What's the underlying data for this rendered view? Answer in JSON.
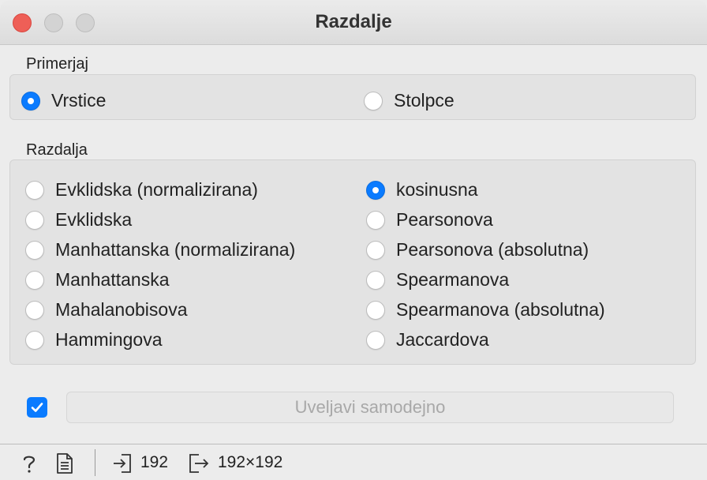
{
  "window": {
    "title": "Razdalje"
  },
  "examples": {
    "label": "Primerjaj",
    "options": [
      {
        "label": "Vrstice",
        "selected": true
      },
      {
        "label": "Stolpce",
        "selected": false
      }
    ]
  },
  "distance": {
    "label": "Razdalja",
    "left": [
      {
        "label": "Evklidska (normalizirana)",
        "selected": false
      },
      {
        "label": "Evklidska",
        "selected": false
      },
      {
        "label": "Manhattanska (normalizirana)",
        "selected": false
      },
      {
        "label": "Manhattanska",
        "selected": false
      },
      {
        "label": "Mahalanobisova",
        "selected": false
      },
      {
        "label": "Hammingova",
        "selected": false
      }
    ],
    "right": [
      {
        "label": "kosinusna",
        "selected": true
      },
      {
        "label": "Pearsonova",
        "selected": false
      },
      {
        "label": "Pearsonova (absolutna)",
        "selected": false
      },
      {
        "label": "Spearmanova",
        "selected": false
      },
      {
        "label": "Spearmanova (absolutna)",
        "selected": false
      },
      {
        "label": "Jaccardova",
        "selected": false
      }
    ]
  },
  "apply": {
    "auto_checked": true,
    "button_label": "Uveljavi samodejno"
  },
  "statusbar": {
    "input_count": "192",
    "output_size": "192×192"
  },
  "colors": {
    "accent": "#0a7bff",
    "close": "#ee5f57"
  }
}
